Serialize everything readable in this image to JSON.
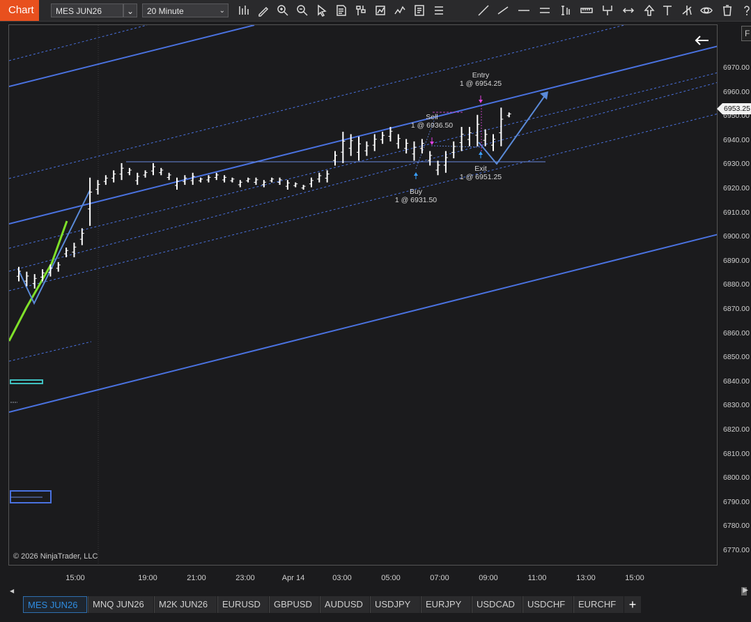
{
  "toolbar": {
    "chart_tab": "Chart",
    "instrument": "MES JUN26",
    "interval": "20 Minute",
    "icons": [
      "bar-style-icon",
      "draw-pencil-icon",
      "zoom-in-icon",
      "zoom-out-icon",
      "pointer-icon",
      "data-box-icon",
      "bar-type-icon",
      "strategies-icon",
      "indicators-icon",
      "templates-icon",
      "properties-icon",
      "line-tool-icon",
      "ray-icon",
      "horizontal-line-icon",
      "range-icon",
      "time-cycle-icon",
      "ruler-icon",
      "fib-icon",
      "arrow-line-icon",
      "arrow-up-icon",
      "text-tool-icon",
      "pitchfork-icon",
      "visibility-icon",
      "delete-icon",
      "help-icon"
    ]
  },
  "f_button": "F",
  "price_axis": [
    "6970.00",
    "6960.00",
    "6950.00",
    "6940.00",
    "6930.00",
    "6920.00",
    "6910.00",
    "6900.00",
    "6890.00",
    "6880.00",
    "6870.00",
    "6860.00",
    "6850.00",
    "6840.00",
    "6830.00",
    "6820.00",
    "6810.00",
    "6800.00",
    "6790.00",
    "6780.00",
    "6770.00"
  ],
  "current_price": "6953.25",
  "time_axis": [
    "15:00",
    "19:00",
    "21:00",
    "23:00",
    "Apr 14",
    "03:00",
    "05:00",
    "07:00",
    "09:00",
    "11:00",
    "13:00",
    "15:00"
  ],
  "annotations": {
    "entry_label": "Entry",
    "entry_value": "1 @ 6954.25",
    "sell_label": "Sell",
    "sell_value": "1 @ 6936.50",
    "exit_label": "Exit",
    "exit_value": "1 @ 6951.25",
    "buy_label": "Buy",
    "buy_value": "1 @ 6931.50"
  },
  "copyright": "© 2026 NinjaTrader, LLC",
  "tabs": [
    "MES JUN26",
    "MNQ JUN26",
    "M2K JUN26",
    "EURUSD",
    "GBPUSD",
    "AUDUSD",
    "USDJPY",
    "EURJPY",
    "USDCAD",
    "USDCHF",
    "EURCHF"
  ],
  "active_tab": "MES JUN26",
  "add_tab": "+",
  "chart_data": {
    "type": "ohlc",
    "instrument": "MES JUN26",
    "interval": "20 Minute",
    "y_range": [
      6765,
      6978
    ],
    "bars": [
      [
        6888,
        6882
      ],
      [
        6886,
        6880
      ],
      [
        6885,
        6879
      ],
      [
        6887,
        6882
      ],
      [
        6889,
        6884
      ],
      [
        6890,
        6886
      ],
      [
        6896,
        6892
      ],
      [
        6898,
        6892
      ],
      [
        6904,
        6897
      ],
      [
        6925,
        6905
      ],
      [
        6924,
        6918
      ],
      [
        6926,
        6922
      ],
      [
        6928,
        6923
      ],
      [
        6931,
        6924
      ],
      [
        6929,
        6926
      ],
      [
        6927,
        6922
      ],
      [
        6928,
        6925
      ],
      [
        6931,
        6926
      ],
      [
        6929,
        6926
      ],
      [
        6927,
        6924
      ],
      [
        6925,
        6920
      ],
      [
        6926,
        6922
      ],
      [
        6927,
        6922
      ],
      [
        6925,
        6923
      ],
      [
        6926,
        6923
      ],
      [
        6927,
        6924
      ],
      [
        6926,
        6923
      ],
      [
        6925,
        6923
      ],
      [
        6924,
        6921
      ],
      [
        6925,
        6923
      ],
      [
        6925,
        6922
      ],
      [
        6924,
        6921
      ],
      [
        6925,
        6923
      ],
      [
        6925,
        6922
      ],
      [
        6924,
        6920
      ],
      [
        6923,
        6921
      ],
      [
        6922,
        6920
      ],
      [
        6925,
        6921
      ],
      [
        6927,
        6923
      ],
      [
        6928,
        6923
      ],
      [
        6936,
        6930
      ],
      [
        6944,
        6931
      ],
      [
        6943,
        6934
      ],
      [
        6942,
        6932
      ],
      [
        6940,
        6934
      ],
      [
        6943,
        6936
      ],
      [
        6944,
        6939
      ],
      [
        6946,
        6940
      ],
      [
        6943,
        6937
      ],
      [
        6941,
        6935
      ],
      [
        6940,
        6932
      ],
      [
        6941,
        6935
      ],
      [
        6936,
        6930
      ],
      [
        6932,
        6926
      ],
      [
        6936,
        6927
      ],
      [
        6940,
        6933
      ],
      [
        6946,
        6936
      ],
      [
        6946,
        6938
      ],
      [
        6951,
        6938
      ],
      [
        6945,
        6938
      ],
      [
        6943,
        6936
      ],
      [
        6954,
        6938
      ],
      [
        6952,
        6950
      ]
    ]
  }
}
